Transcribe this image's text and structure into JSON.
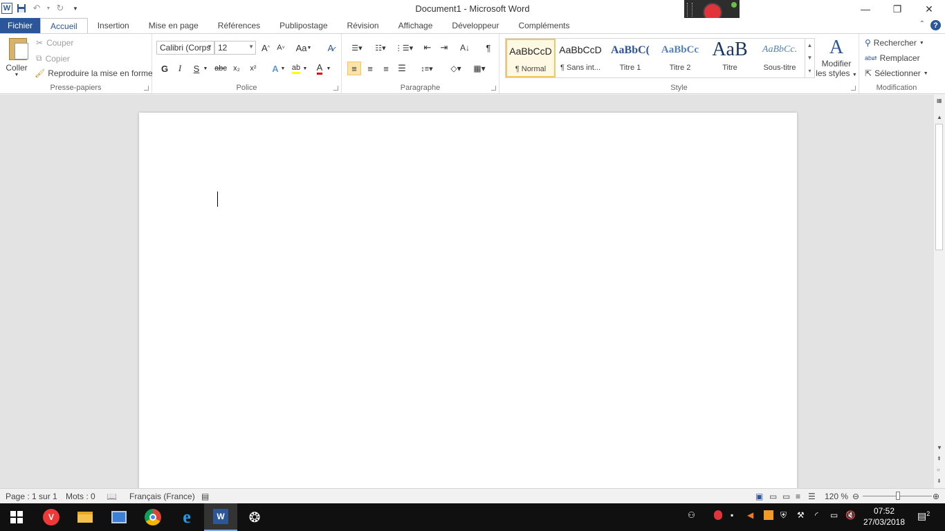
{
  "window": {
    "title": "Document1  -  Microsoft Word"
  },
  "tabs": [
    "Fichier",
    "Accueil",
    "Insertion",
    "Mise en page",
    "Références",
    "Publipostage",
    "Révision",
    "Affichage",
    "Développeur",
    "Compléments"
  ],
  "clipboard": {
    "paste_label": "Coller",
    "cut_label": "Couper",
    "copy_label": "Copier",
    "format_painter_label": "Reproduire la mise en forme",
    "group_label": "Presse-papiers"
  },
  "font": {
    "font_name": "Calibri (Corps",
    "font_size": "12",
    "bold": "G",
    "italic": "I",
    "underline": "S",
    "strike": "abc",
    "subscript": "x₂",
    "superscript": "x²",
    "case": "Aa",
    "grow": "A",
    "shrink": "A",
    "group_label": "Police"
  },
  "paragraph": {
    "group_label": "Paragraphe",
    "show_marks": "¶"
  },
  "styles": {
    "group_label": "Style",
    "items": [
      {
        "preview": "AaBbCcD",
        "name": "¶ Normal",
        "selected": true
      },
      {
        "preview": "AaBbCcD",
        "name": "¶ Sans int..."
      },
      {
        "preview": "AaBbC(",
        "name": "Titre 1"
      },
      {
        "preview": "AaBbCc",
        "name": "Titre 2"
      },
      {
        "preview": "AaB",
        "name": "Titre"
      },
      {
        "preview": "AaBbCc.",
        "name": "Sous-titre"
      }
    ],
    "modify_label_1": "Modifier",
    "modify_label_2": "les styles"
  },
  "editing": {
    "find_label": "Rechercher",
    "replace_label": "Remplacer",
    "select_label": "Sélectionner",
    "group_label": "Modification"
  },
  "statusbar": {
    "page": "Page : 1 sur 1",
    "words": "Mots : 0",
    "language": "Français (France)",
    "zoom": "120 %",
    "zoom_level_percent": 120
  },
  "taskbar": {
    "time": "07:52",
    "date": "27/03/2018",
    "notifications": "2"
  },
  "colors": {
    "accent": "#2b579a",
    "highlight": "#fce4a8"
  }
}
